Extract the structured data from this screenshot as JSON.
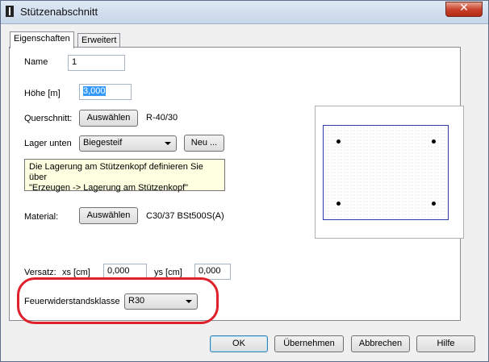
{
  "window": {
    "title": "Stützenabschnitt",
    "close_label": "✕"
  },
  "tabs": [
    {
      "label": "Eigenschaften"
    },
    {
      "label": "Erweitert"
    }
  ],
  "fields": {
    "name_label": "Name",
    "name_value": "1",
    "hoehe_label": "Höhe [m]",
    "hoehe_value": "3,000",
    "querschnitt_label": "Querschnitt:",
    "querschnitt_button": "Auswählen",
    "querschnitt_value": "R-40/30",
    "lager_label": "Lager unten",
    "lager_value": "Biegesteif",
    "lager_new_button": "Neu ...",
    "lager_hint_line1": "Die Lagerung am Stützenkopf definieren Sie über",
    "lager_hint_line2": "\"Erzeugen -> Lagerung am Stützenkopf\"",
    "material_label": "Material:",
    "material_button": "Auswählen",
    "material_value": "C30/37 BSt500S(A)",
    "versatz_label": "Versatz:",
    "xs_label": "xs [cm]",
    "xs_value": "0,000",
    "ys_label": "ys [cm]",
    "ys_value": "0,000",
    "feuer_label": "Feuerwiderstandsklasse",
    "feuer_value": "R30"
  },
  "colors": {
    "section_border": "#2f3aa8",
    "highlight": "#e0202a",
    "selection": "#3399ff"
  },
  "buttons": {
    "ok": "OK",
    "apply": "Übernehmen",
    "cancel": "Abbrechen",
    "help": "Hilfe"
  }
}
